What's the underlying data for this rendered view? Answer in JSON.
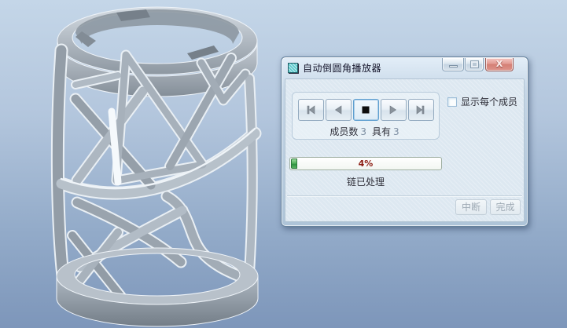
{
  "viewport": {
    "background_top": "#c4d6e8",
    "background_bottom": "#7d96ba",
    "model": {
      "name": "lattice-cylinder-part",
      "body_color": "#a9b3bd",
      "edge_highlight": "#eef3f8"
    }
  },
  "dialog": {
    "title": "自动倒圆角播放器",
    "titlebar_icon": "teal-cube-icon",
    "window_controls": {
      "minimize_icon": "minimize-icon",
      "maximize_icon": "maximize-icon",
      "close_icon": "close-icon",
      "close_glyph": "X"
    },
    "player": {
      "buttons": [
        {
          "name": "skip-to-first-button",
          "icon": "skip-to-first-icon",
          "active": false
        },
        {
          "name": "previous-member-button",
          "icon": "previous-icon",
          "active": false
        },
        {
          "name": "stop-button",
          "icon": "stop-icon",
          "active": true
        },
        {
          "name": "next-member-button",
          "icon": "next-icon",
          "active": false
        },
        {
          "name": "skip-to-last-button",
          "icon": "skip-to-last-icon",
          "active": false
        }
      ],
      "members_text": {
        "prefix": "成员数",
        "count": "3",
        "middle": "具有",
        "total": "3"
      }
    },
    "show_each_member": {
      "label": "显示每个成员",
      "checked": false
    },
    "progress": {
      "percent": 4,
      "percent_label": "4%",
      "caption": "链已处理",
      "fill_color": "#4fae57",
      "label_color": "#8b1a10"
    },
    "footer": {
      "interrupt": {
        "label": "中断",
        "enabled": false
      },
      "done": {
        "label": "完成",
        "enabled": false
      }
    }
  }
}
